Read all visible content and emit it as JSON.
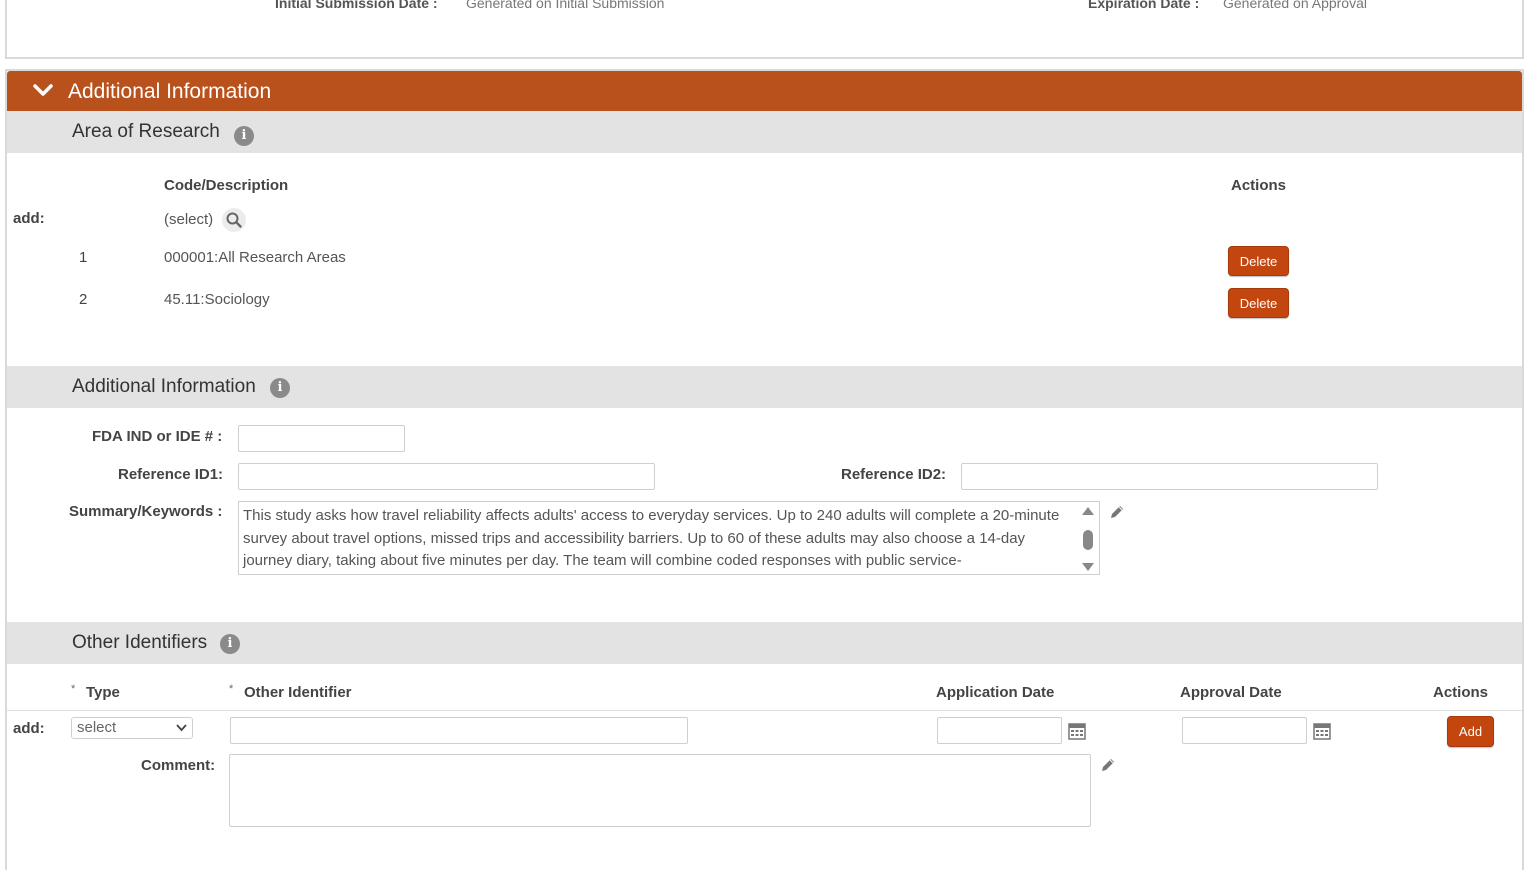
{
  "top": {
    "initial_submission_label": "Initial Submission Date :",
    "initial_submission_value": "Generated on Initial Submission",
    "expiration_label": "Expiration Date :",
    "expiration_value": "Generated on Approval"
  },
  "panel": {
    "title": "Additional Information",
    "header_color": "#b9511c"
  },
  "area_of_research": {
    "title": "Area of Research",
    "col_code": "Code/Description",
    "col_actions": "Actions",
    "add_label": "add:",
    "select_text": "(select)",
    "rows": [
      {
        "num": "1",
        "desc": "000001:All Research Areas",
        "action": "Delete"
      },
      {
        "num": "2",
        "desc": "45.11:Sociology",
        "action": "Delete"
      }
    ]
  },
  "additional_info": {
    "title": "Additional Information",
    "fda_label": "FDA IND or IDE # :",
    "fda_value": "",
    "ref1_label": "Reference ID1:",
    "ref1_value": "",
    "ref2_label": "Reference ID2:",
    "ref2_value": "",
    "summary_label": "Summary/Keywords :",
    "summary_text": "This study asks how travel reliability affects adults' access to everyday services. Up to 240 adults will complete a 20-minute survey about travel options, missed trips and accessibility barriers. Up to 60 of these adults may also choose a 14-day journey diary, taking about five minutes per day. The team will combine coded responses with public service-"
  },
  "other_identifiers": {
    "title": "Other Identifiers",
    "col_type": "Type",
    "col_other_identifier": "Other Identifier",
    "col_application_date": "Application Date",
    "col_approval_date": "Approval Date",
    "col_actions": "Actions",
    "required_marker": "*",
    "add_label": "add:",
    "type_selected": "select",
    "comment_label": "Comment:",
    "add_button": "Add"
  }
}
